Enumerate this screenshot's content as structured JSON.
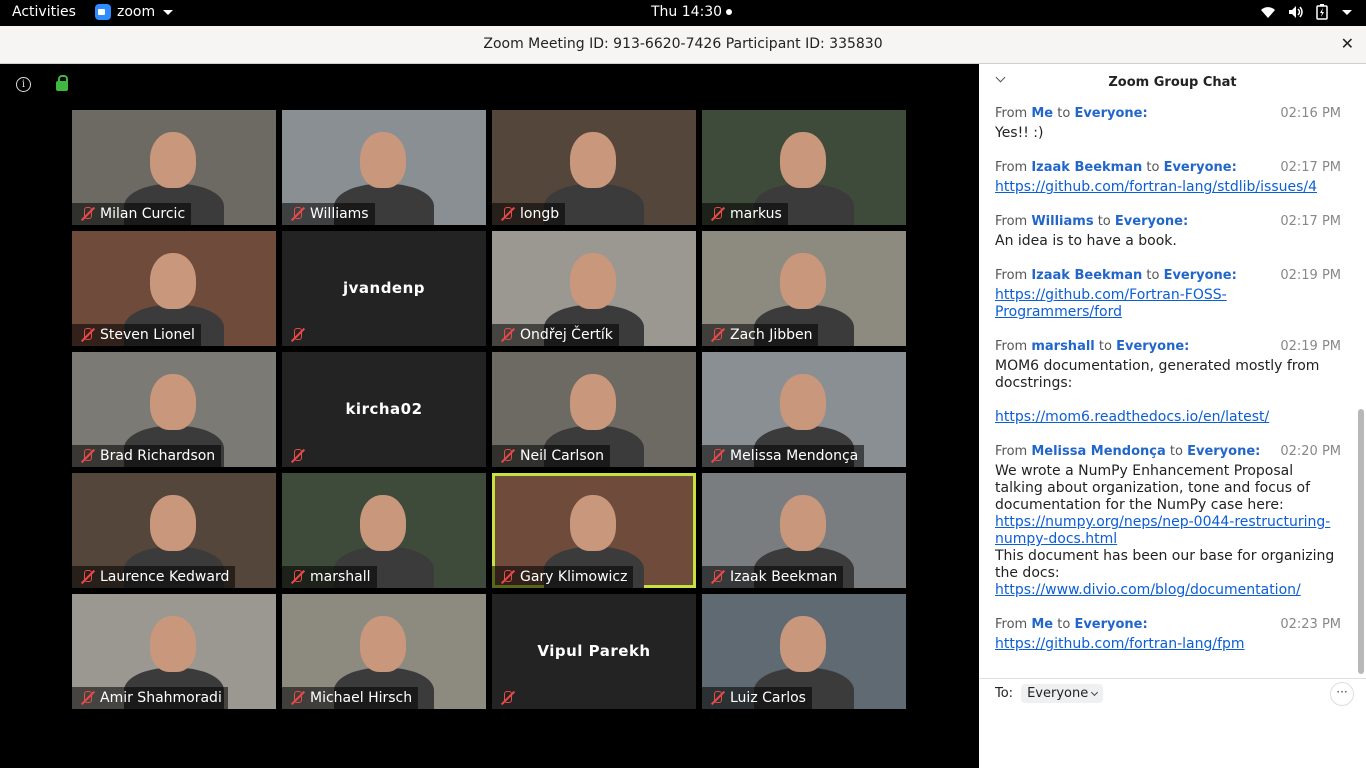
{
  "topbar": {
    "activities": "Activities",
    "app_name": "zoom",
    "clock": "Thu 14:30"
  },
  "window": {
    "title": "Zoom Meeting ID: 913-6620-7426 Participant ID: 335830"
  },
  "tiles": [
    {
      "name": "Milan Curcic",
      "video": true
    },
    {
      "name": "Williams",
      "video": true
    },
    {
      "name": "longb",
      "video": true
    },
    {
      "name": "markus",
      "video": true
    },
    {
      "name": "Steven Lionel",
      "video": true
    },
    {
      "name": "jvandenp",
      "video": false
    },
    {
      "name": "Ondřej Čertík",
      "video": true
    },
    {
      "name": "Zach Jibben",
      "video": true
    },
    {
      "name": "Brad Richardson",
      "video": true
    },
    {
      "name": "kircha02",
      "video": false
    },
    {
      "name": "Neil Carlson",
      "video": true
    },
    {
      "name": "Melissa Mendonça",
      "video": true
    },
    {
      "name": "Laurence Kedward",
      "video": true
    },
    {
      "name": "marshall",
      "video": true
    },
    {
      "name": "Gary Klimowicz",
      "video": true,
      "active": true
    },
    {
      "name": "Izaak Beekman",
      "video": true
    },
    {
      "name": "Amir Shahmoradi",
      "video": true
    },
    {
      "name": "Michael Hirsch",
      "video": true
    },
    {
      "name": "Vipul Parekh",
      "video": false
    },
    {
      "name": "Luiz Carlos",
      "video": true
    }
  ],
  "chat": {
    "title": "Zoom Group Chat",
    "messages": [
      {
        "from": "Me",
        "to": "Everyone",
        "time": "02:16 PM",
        "parts": [
          {
            "t": "Yes!! :)"
          }
        ]
      },
      {
        "from": "Izaak Beekman",
        "to": "Everyone",
        "time": "02:17 PM",
        "parts": [
          {
            "link": "https://github.com/fortran-lang/stdlib/issues/4"
          }
        ]
      },
      {
        "from": "Williams",
        "to": "Everyone",
        "time": "02:17 PM",
        "parts": [
          {
            "t": "An idea is to have a book."
          }
        ]
      },
      {
        "from": "Izaak Beekman",
        "to": "Everyone",
        "time": "02:19 PM",
        "parts": [
          {
            "link": "https://github.com/Fortran-FOSS-Programmers/ford"
          }
        ]
      },
      {
        "from": "marshall",
        "to": "Everyone",
        "time": "02:19 PM",
        "parts": [
          {
            "t": "MOM6 documentation, generated mostly from docstrings:"
          },
          {
            "br": true
          },
          {
            "br": true
          },
          {
            "link": "https://mom6.readthedocs.io/en/latest/"
          }
        ]
      },
      {
        "from": "Melissa Mendonça",
        "to": "Everyone",
        "time": "02:20 PM",
        "parts": [
          {
            "t": "We wrote a NumPy Enhancement Proposal talking about organization, tone and focus of documentation for the NumPy case here: "
          },
          {
            "link": "https://numpy.org/neps/nep-0044-restructuring-numpy-docs.html"
          },
          {
            "br": true
          },
          {
            "t": "This document has been our base for organizing the docs: "
          },
          {
            "link": "https://www.divio.com/blog/documentation/"
          }
        ]
      },
      {
        "from": "Me",
        "to": "Everyone",
        "time": "02:23 PM",
        "parts": [
          {
            "link": "https://github.com/fortran-lang/fpm"
          }
        ]
      }
    ],
    "label_from": "From",
    "label_to": "to",
    "to_label": "To:",
    "to_value": "Everyone",
    "more": "···"
  }
}
